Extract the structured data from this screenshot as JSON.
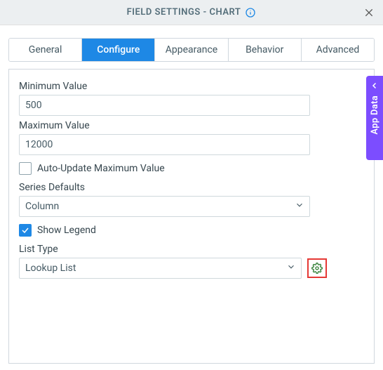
{
  "header": {
    "title": "FIELD SETTINGS - CHART"
  },
  "tabs": {
    "general": "General",
    "configure": "Configure",
    "appearance": "Appearance",
    "behavior": "Behavior",
    "advanced": "Advanced"
  },
  "form": {
    "min_label": "Minimum Value",
    "min_value": "500",
    "max_label": "Maximum Value",
    "max_value": "12000",
    "auto_update_label": "Auto-Update Maximum Value",
    "series_defaults_label": "Series Defaults",
    "series_defaults_value": "Column",
    "show_legend_label": "Show Legend",
    "list_type_label": "List Type",
    "list_type_value": "Lookup List"
  },
  "sidetab": {
    "label": "App Data"
  }
}
